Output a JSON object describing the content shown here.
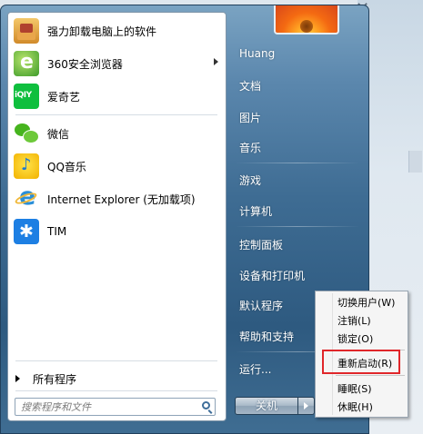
{
  "start_menu": {
    "programs": [
      {
        "label": "强力卸载电脑上的软件",
        "icon": "uninstall-box-icon",
        "submenu": false
      },
      {
        "label": "360安全浏览器",
        "icon": "360-browser-icon",
        "submenu": true
      },
      {
        "label": "爱奇艺",
        "icon": "iqiyi-icon",
        "submenu": false
      },
      {
        "label": "微信",
        "icon": "wechat-icon",
        "submenu": false
      },
      {
        "label": "QQ音乐",
        "icon": "qq-music-icon",
        "submenu": false
      },
      {
        "label": "Internet Explorer (无加载项)",
        "icon": "internet-explorer-icon",
        "submenu": false
      },
      {
        "label": "TIM",
        "icon": "tim-icon",
        "submenu": false
      }
    ],
    "all_programs": "所有程序",
    "search": {
      "placeholder": "搜索程序和文件"
    },
    "user": {
      "avatar_icon": "flower-avatar-icon"
    },
    "right_items": [
      "Huang",
      "文档",
      "图片",
      "音乐",
      "游戏",
      "计算机",
      "控制面板",
      "设备和打印机",
      "默认程序",
      "帮助和支持",
      "运行..."
    ],
    "shutdown": {
      "label": "关机"
    },
    "power_submenu": {
      "items": [
        "切换用户(W)",
        "注销(L)",
        "锁定(O)",
        "重新启动(R)",
        "睡眠(S)",
        "休眠(H)"
      ],
      "highlighted": "重新启动(R)"
    }
  },
  "colors": {
    "highlight_border": "#e0262a",
    "menu_blue": "#3e6c93"
  }
}
